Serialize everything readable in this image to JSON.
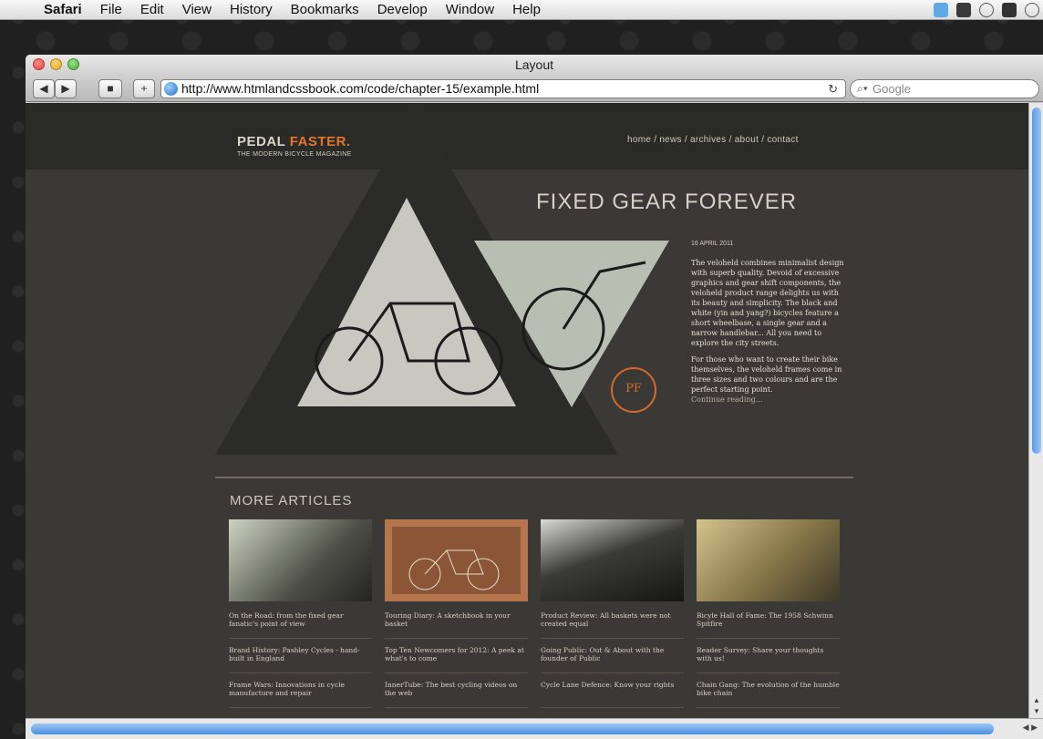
{
  "menubar": {
    "app": "Safari",
    "items": [
      "File",
      "Edit",
      "View",
      "History",
      "Bookmarks",
      "Develop",
      "Window",
      "Help"
    ]
  },
  "window": {
    "title": "Layout",
    "url": "http://www.htmlandcssbook.com/code/chapter-15/example.html",
    "search_placeholder": "Google",
    "reload_icon": "↻"
  },
  "site": {
    "logo_word1": "PEDAL",
    "logo_word2": "FASTER.",
    "tagline": "THE MODERN BICYCLE MAGAZINE",
    "nav": [
      "home",
      "news",
      "archives",
      "about",
      "contact"
    ],
    "headline": "FIXED GEAR FOREVER",
    "date": "16 APRIL 2011",
    "paragraph1": "The veloheld combines minimalist design with superb quality. Devoid of excessive graphics and gear shift components, the veloheld product range delights us with its beauty and simplicity. The black and white (yin and yang?) bicycles feature a short wheelbase, a single gear and a narrow handlebar... All you need to explore the city streets.",
    "paragraph2": "For those who want to create their bike themselves, the veloheld frames come in three sizes and two colours and are the perfect starting point.",
    "continue": "Continue reading...",
    "badge": "PF",
    "more_title": "MORE ARTICLES",
    "columns": [
      [
        "On the Road: from the fixed gear fanatic's point of view",
        "Brand History: Pashley Cycles - hand-built in England",
        "Frame Wars: Innovations in cycle manufacture and repair"
      ],
      [
        "Touring Diary: A sketchbook in your basket",
        "Top Ten Newcomers for 2012: A peek at what's to come",
        "InnerTube: The best cycling videos on the web"
      ],
      [
        "Product Review: All baskets were not created equal",
        "Going Public: Out & About with the founder of Public",
        "Cycle Lane Defence: Know your rights"
      ],
      [
        "Bicyle Hall of Fame: The 1958 Schwinn Spitfire",
        "Reader Survey: Share your thoughts with us!",
        "Chain Gang: The evolution of the humble bike chain"
      ]
    ]
  },
  "colors": {
    "accent": "#e2742e",
    "page_bg": "#3a3935",
    "header_bg": "#2a2a27",
    "triangle": "#2b2b27"
  }
}
